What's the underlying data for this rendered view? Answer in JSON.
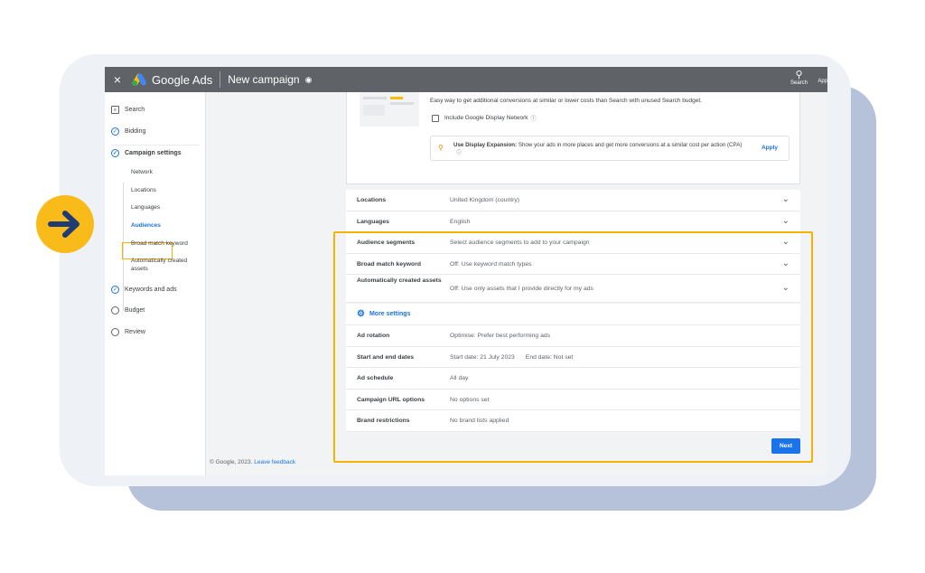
{
  "app": {
    "close": "×",
    "brand": "Google Ads",
    "title": "New campaign",
    "search_label": "Search",
    "apps_label": "App"
  },
  "sidebar": {
    "items": [
      {
        "label": "Search",
        "state": "doc"
      },
      {
        "label": "Bidding",
        "state": "done"
      },
      {
        "label": "Campaign settings",
        "state": "done"
      },
      {
        "label": "Keywords and ads",
        "state": "done"
      },
      {
        "label": "Budget",
        "state": "todo"
      },
      {
        "label": "Review",
        "state": "todo"
      }
    ],
    "sub_items": [
      "Network",
      "Locations",
      "Languages",
      "Audiences",
      "Broad match keyword",
      "Automatically created assets"
    ],
    "active_sub": "Audiences"
  },
  "network_panel": {
    "description": "Easy way to get additional conversions at similar or lower costs than Search with unused Search budget.",
    "checkbox_label": "Include Google Display Network",
    "expansion_title": "Use Display Expansion:",
    "expansion_text": "Show your ads in more places and get more conversions at a similar cost per action (CPA)",
    "apply_label": "Apply"
  },
  "settings": [
    {
      "label": "Locations",
      "value": "United Kingdom (country)"
    },
    {
      "label": "Languages",
      "value": "English"
    },
    {
      "label": "Audience segments",
      "value": "Select audience segments to add to your campaign"
    },
    {
      "label": "Broad match keyword",
      "value": "Off: Use keyword match types"
    },
    {
      "label": "Automatically created assets",
      "value": "Off: Use only assets that I provide directly for my ads"
    }
  ],
  "more_settings_label": "More settings",
  "more_settings": [
    {
      "label": "Ad rotation",
      "value": "Optimise: Prefer best performing ads"
    },
    {
      "label": "Start and end dates",
      "value": "Start date: 21 July 2023",
      "value2": "End date: Not set"
    },
    {
      "label": "Ad schedule",
      "value": "All day"
    },
    {
      "label": "Campaign URL options",
      "value": "No options set"
    },
    {
      "label": "Brand restrictions",
      "value": "No brand lists applied"
    }
  ],
  "next_label": "Next",
  "footer": {
    "copyright": "© Google, 2023.",
    "link": "Leave feedback"
  },
  "colors": {
    "accent": "#1a73e8",
    "highlight": "#f4b400",
    "arrow_badge": "#f8bb19",
    "arrow": "#1f3b73"
  }
}
